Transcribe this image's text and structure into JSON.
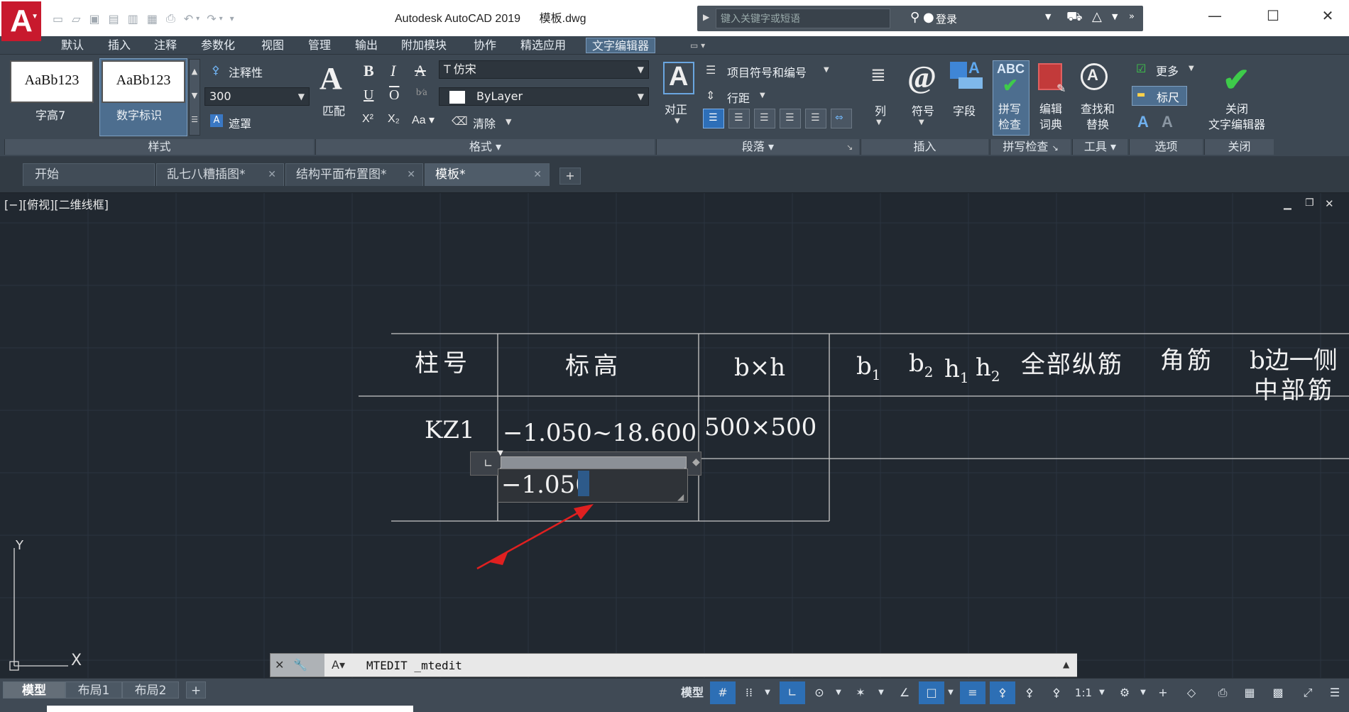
{
  "app": {
    "window_title": "Autodesk AutoCAD 2019      模板.dwg",
    "logo_letter": "A",
    "search_placeholder": "键入关键字或短语",
    "login_label": "登录"
  },
  "menu_tabs": [
    "默认",
    "插入",
    "注释",
    "参数化",
    "视图",
    "管理",
    "输出",
    "附加模块",
    "协作",
    "精选应用",
    "文字编辑器"
  ],
  "active_menu_tab": "文字编辑器",
  "ribbon": {
    "style_panel": {
      "swatch1_sample": "AaBb123",
      "swatch1_label": "字高7",
      "swatch2_sample": "AaBb123",
      "swatch2_label": "数字标识",
      "annotative_label": "注释性",
      "text_height_value": "300",
      "mask_label": "遮罩",
      "title": "样式"
    },
    "format_panel": {
      "match_label": "匹配",
      "font_value": "仿宋",
      "color_value": "ByLayer",
      "clear_label": "清除",
      "title": "格式"
    },
    "paragraph_panel": {
      "justify_label": "对正",
      "bullets_label": "项目符号和编号",
      "line_spacing_label": "行距",
      "title": "段落"
    },
    "insert_panel": {
      "columns_label": "列",
      "symbol_label": "符号",
      "field_label": "字段",
      "title": "插入"
    },
    "spell_panel": {
      "spell_check_label": "拼写\n检查",
      "edit_dict_label": "编辑\n词典",
      "title": "拼写检查"
    },
    "tools_panel": {
      "find_replace_label": "查找和\n替换",
      "title": "工具"
    },
    "options_panel": {
      "more_label": "更多",
      "ruler_label": "标尺",
      "title": "选项"
    },
    "close_panel": {
      "close_editor_label": "关闭\n文字编辑器",
      "title": "关闭"
    }
  },
  "doc_tabs": [
    {
      "label": "开始",
      "closable": false
    },
    {
      "label": "乱七八糟插图*",
      "closable": true
    },
    {
      "label": "结构平面布置图*",
      "closable": true
    },
    {
      "label": "模板*",
      "closable": true
    }
  ],
  "active_doc_tab": "模板*",
  "viewport_label": "[−][俯视][二维线框]",
  "table": {
    "headers": [
      "柱号",
      "标高",
      "b×h",
      "b1",
      "b2",
      "h1",
      "h2",
      "全部纵筋",
      "角筋",
      "b边一侧",
      "中部筋"
    ],
    "row1": {
      "column_no": "KZ1",
      "elevation": "−1.050~18.600",
      "size": "500×500"
    },
    "editing_text": "−1.050"
  },
  "ucs": {
    "y": "Y",
    "x": "X"
  },
  "command_line": {
    "text": "MTEDIT _mtedit"
  },
  "layout_tabs": [
    "模型",
    "布局1",
    "布局2"
  ],
  "active_layout_tab": "模型",
  "statusbar": {
    "model_label": "模型",
    "scale_label": "1:1"
  },
  "colors": {
    "accent": "#2e6fb8",
    "canvas": "#212830",
    "arrow": "#e02020",
    "logo": "#c8192d"
  }
}
